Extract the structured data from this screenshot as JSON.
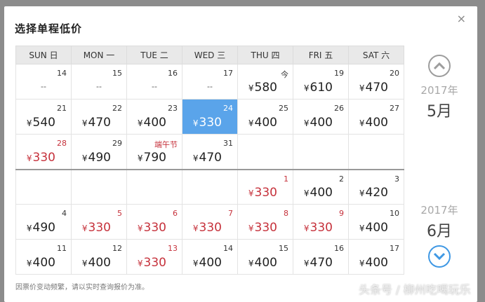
{
  "title": "选择单程低价",
  "close_glyph": "×",
  "weekdays": [
    "SUN 日",
    "MON 一",
    "TUE 二",
    "WED 三",
    "THU 四",
    "FRI 五",
    "SAT 六"
  ],
  "currency": "¥",
  "rows": [
    [
      {
        "d": "14",
        "p": "--"
      },
      {
        "d": "15",
        "p": "--"
      },
      {
        "d": "16",
        "p": "--"
      },
      {
        "d": "17",
        "p": "--"
      },
      {
        "d": "今",
        "p": "580"
      },
      {
        "d": "19",
        "p": "610"
      },
      {
        "d": "20",
        "p": "470"
      }
    ],
    [
      {
        "d": "21",
        "p": "540"
      },
      {
        "d": "22",
        "p": "470"
      },
      {
        "d": "23",
        "p": "400"
      },
      {
        "d": "24",
        "p": "330",
        "sel": true
      },
      {
        "d": "25",
        "p": "400"
      },
      {
        "d": "26",
        "p": "400"
      },
      {
        "d": "27",
        "p": "400"
      }
    ],
    [
      {
        "d": "28",
        "p": "330",
        "red": true
      },
      {
        "d": "29",
        "p": "490"
      },
      {
        "d": "端午节",
        "p": "790",
        "dred": true
      },
      {
        "d": "31",
        "p": "470"
      },
      {},
      {},
      {}
    ],
    [
      {},
      {},
      {},
      {},
      {
        "d": "1",
        "p": "330",
        "red": true
      },
      {
        "d": "2",
        "p": "400"
      },
      {
        "d": "3",
        "p": "420"
      }
    ],
    [
      {
        "d": "4",
        "p": "490"
      },
      {
        "d": "5",
        "p": "330",
        "red": true
      },
      {
        "d": "6",
        "p": "330",
        "red": true
      },
      {
        "d": "7",
        "p": "330",
        "red": true
      },
      {
        "d": "8",
        "p": "330",
        "red": true
      },
      {
        "d": "9",
        "p": "330",
        "red": true
      },
      {
        "d": "10",
        "p": "400"
      }
    ],
    [
      {
        "d": "11",
        "p": "400"
      },
      {
        "d": "12",
        "p": "400"
      },
      {
        "d": "13",
        "p": "330",
        "red": true
      },
      {
        "d": "14",
        "p": "400"
      },
      {
        "d": "15",
        "p": "400"
      },
      {
        "d": "16",
        "p": "470"
      },
      {
        "d": "17",
        "p": "400"
      }
    ]
  ],
  "months": [
    {
      "year": "2017年",
      "month": "5月"
    },
    {
      "year": "2017年",
      "month": "6月"
    }
  ],
  "note": "因票价变动频繁，请以实时查询报价为准。",
  "watermark": "头条号 / 柳州吃喝玩乐",
  "colors": {
    "selected": "#5aa4ea",
    "low_price": "#c6323c",
    "nav_active": "#3f98e4",
    "nav_inactive": "#9d9d9d"
  }
}
